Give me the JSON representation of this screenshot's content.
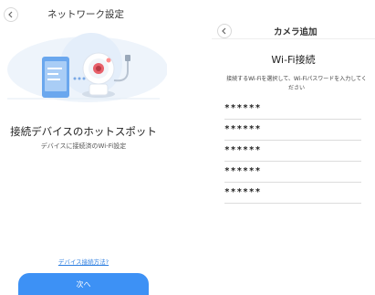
{
  "left_screen": {
    "nav_title": "ネットワーク設定",
    "headline": "接続デバイスのホットスポット",
    "subline": "デバイスに接続済のWi-Fi設定",
    "help_link": "デバイス接続方法?",
    "next_button": "次へ"
  },
  "right_screen": {
    "nav_title": "カメラ追加",
    "wifi_title": "Wi-Fi接続",
    "description": "接続するWi-Fiを選択して、Wi-Fiパスワードを入力してください",
    "networks": [
      {
        "ssid": "******"
      },
      {
        "ssid": "******"
      },
      {
        "ssid": "******"
      },
      {
        "ssid": "******"
      },
      {
        "ssid": "******"
      }
    ]
  },
  "colors": {
    "accent": "#3d91f5",
    "link": "#2b7de0",
    "hero_bg": "#eaf2fb"
  }
}
